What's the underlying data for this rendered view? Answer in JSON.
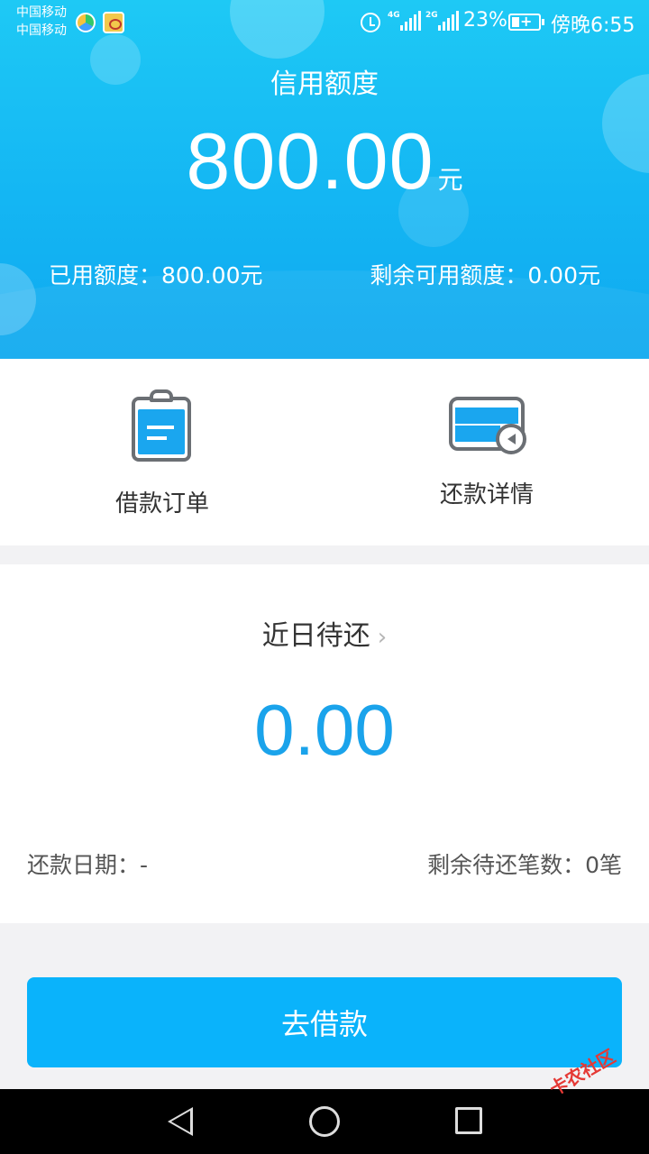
{
  "status_bar": {
    "carrier_1": "中国移动",
    "carrier_2": "中国移动",
    "net_1": "4G",
    "net_2": "2G",
    "battery_percent": "23%",
    "time": "傍晚6:55"
  },
  "credit": {
    "title": "信用额度",
    "amount": "800.00",
    "unit": "元",
    "used": "已用额度：800.00元",
    "remaining": "剩余可用额度：0.00元"
  },
  "shortcuts": {
    "orders_label": "借款订单",
    "repayment_label": "还款详情"
  },
  "due": {
    "title": "近日待还",
    "chevron": "›",
    "amount": "0.00",
    "date": "还款日期：-",
    "count": "剩余待还笔数：0笔"
  },
  "action": {
    "borrow_label": "去借款"
  },
  "watermark": "卡农社区",
  "colors": {
    "accent": "#0ab3fb",
    "amount_blue": "#1aa3eb",
    "header_top": "#1ec9f5"
  },
  "icons": [
    "alarm-icon",
    "battery-icon",
    "clipboard-icon",
    "card-return-icon",
    "chevron-right-icon",
    "back-icon",
    "home-icon",
    "recent-apps-icon"
  ]
}
